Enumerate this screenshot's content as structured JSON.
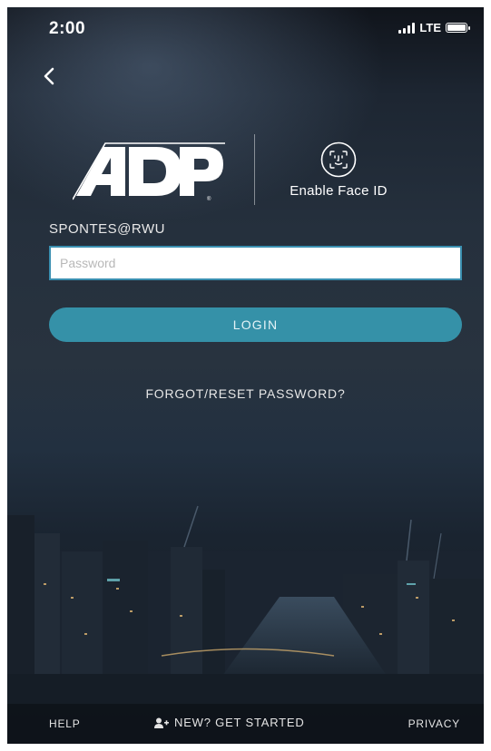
{
  "status_bar": {
    "time": "2:00",
    "network": "LTE",
    "battery_icon": "battery-icon",
    "signal_icon": "signal-icon"
  },
  "nav": {
    "back_icon": "back-chevron-icon"
  },
  "brand": {
    "logo_text": "ADP",
    "logo_icon": "adp-logo-icon"
  },
  "face_id": {
    "label": "Enable Face ID",
    "icon": "face-id-icon"
  },
  "login_form": {
    "username": "SPONTES@RWU",
    "password_placeholder": "Password",
    "password_value": "",
    "login_label": "LOGIN",
    "forgot_label": "FORGOT/RESET PASSWORD?"
  },
  "footer": {
    "help_label": "HELP",
    "get_started_label": "NEW? GET STARTED",
    "get_started_icon": "add-user-icon",
    "privacy_label": "PRIVACY"
  },
  "colors": {
    "accent": "#3591a8",
    "input_border": "#3a8fb0",
    "text_light": "#ffffff"
  }
}
